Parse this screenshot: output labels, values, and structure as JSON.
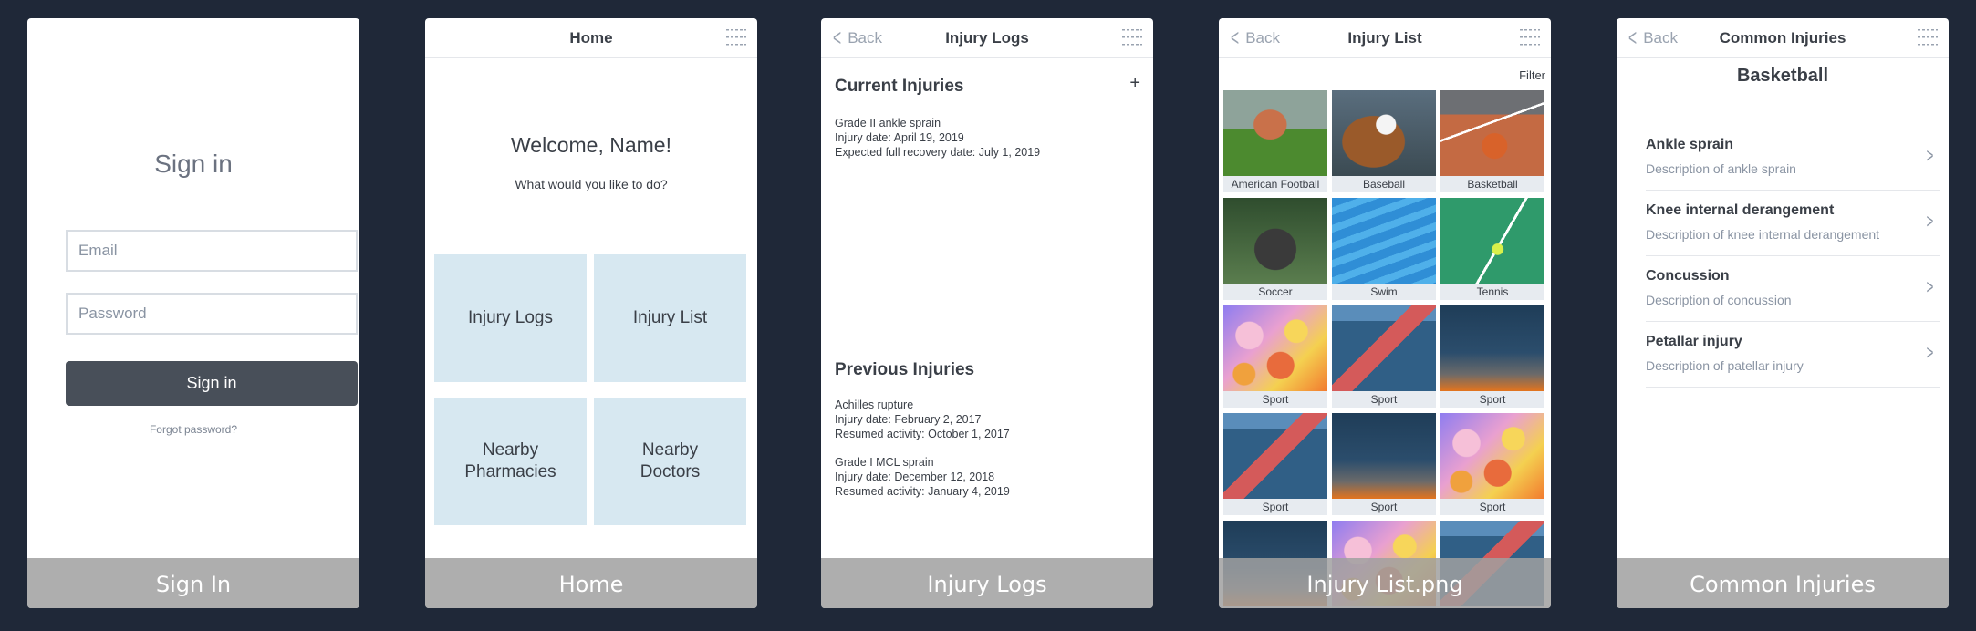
{
  "colors": {
    "background": "#1f2838",
    "primary_button": "#484f59",
    "tile": "#d7e8f1",
    "caption_bar": "#a0a0a0"
  },
  "signin": {
    "caption": "Sign In",
    "title": "Sign in",
    "email_placeholder": "Email",
    "password_placeholder": "Password",
    "button_label": "Sign in",
    "forgot_label": "Forgot password?"
  },
  "home": {
    "caption": "Home",
    "nav_title": "Home",
    "welcome": "Welcome, Name!",
    "prompt": "What would you like to do?",
    "tiles": [
      {
        "label": "Injury Logs"
      },
      {
        "label": "Injury List"
      },
      {
        "label": "Nearby\nPharmacies"
      },
      {
        "label": "Nearby\nDoctors"
      }
    ]
  },
  "logs": {
    "caption": "Injury Logs",
    "nav_back": "Back",
    "nav_title": "Injury Logs",
    "current_heading": "Current Injuries",
    "add_label": "+",
    "current": [
      {
        "name": "Grade II ankle sprain",
        "date": "Injury date: April 19, 2019",
        "status": "Expected full recovery date: July 1, 2019"
      }
    ],
    "previous_heading": "Previous Injuries",
    "previous": [
      {
        "name": "Achilles rupture",
        "date": "Injury date: February 2, 2017",
        "status": "Resumed activity: October 1, 2017"
      },
      {
        "name": "Grade I MCL sprain",
        "date": "Injury date: December 12, 2018",
        "status": "Resumed activity: January 4, 2019"
      }
    ]
  },
  "list": {
    "caption": "Injury List.png",
    "nav_back": "Back",
    "nav_title": "Injury List",
    "filter_label": "Filter",
    "sports": [
      {
        "label": "American Football",
        "photo": "ph-football"
      },
      {
        "label": "Baseball",
        "photo": "ph-baseball"
      },
      {
        "label": "Basketball",
        "photo": "ph-basketball"
      },
      {
        "label": "Soccer",
        "photo": "ph-soccer"
      },
      {
        "label": "Swim",
        "photo": "ph-swim"
      },
      {
        "label": "Tennis",
        "photo": "ph-tennis"
      },
      {
        "label": "Sport",
        "photo": "ph-bubbles"
      },
      {
        "label": "Sport",
        "photo": "ph-court"
      },
      {
        "label": "Sport",
        "photo": "ph-dusk"
      },
      {
        "label": "Sport",
        "photo": "ph-court"
      },
      {
        "label": "Sport",
        "photo": "ph-dusk"
      },
      {
        "label": "Sport",
        "photo": "ph-bubbles"
      },
      {
        "label": "",
        "photo": "ph-dusk"
      },
      {
        "label": "",
        "photo": "ph-bubbles"
      },
      {
        "label": "",
        "photo": "ph-court"
      }
    ]
  },
  "common": {
    "caption": "Common Injuries",
    "nav_back": "Back",
    "nav_title": "Common Injuries",
    "sport": "Basketball",
    "injuries": [
      {
        "title": "Ankle sprain",
        "desc": "Description of ankle sprain"
      },
      {
        "title": "Knee internal derangement",
        "desc": "Description of knee internal derangement"
      },
      {
        "title": "Concussion",
        "desc": "Description of concussion"
      },
      {
        "title": "Petallar injury",
        "desc": "Description of patellar injury"
      }
    ]
  }
}
